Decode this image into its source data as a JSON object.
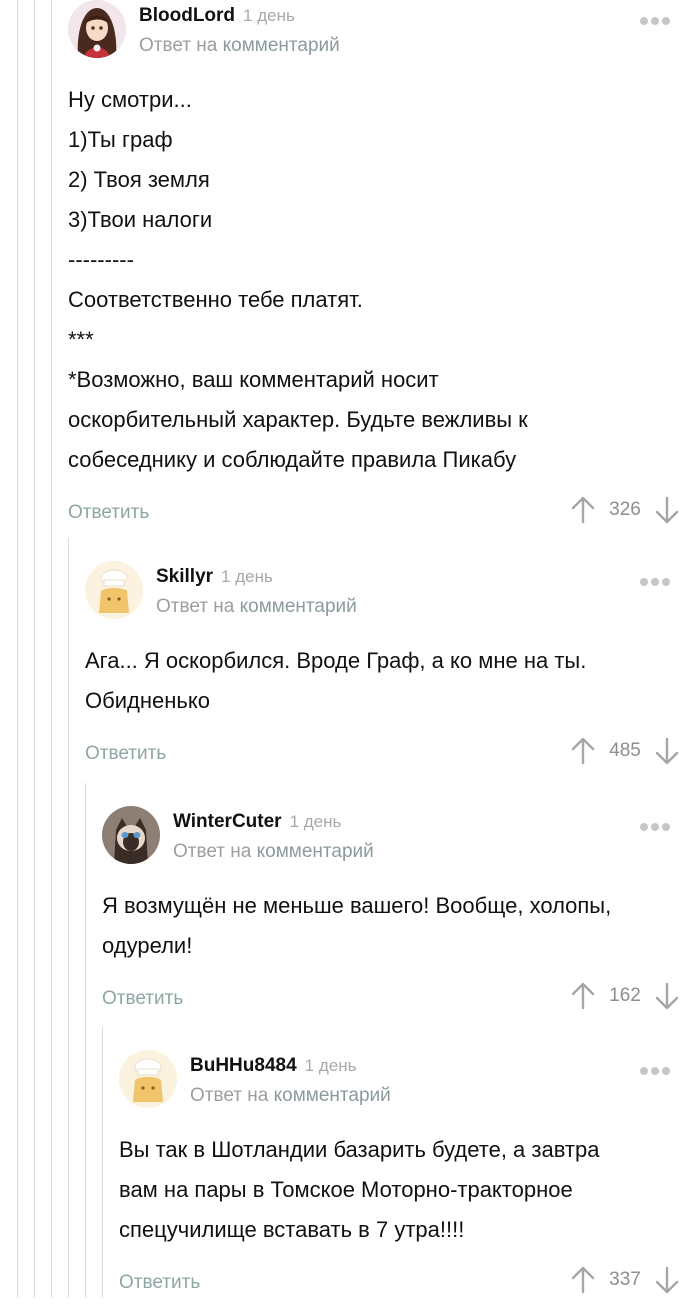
{
  "comments": [
    {
      "username": "BloodLord",
      "time": "1 день",
      "reply_prefix": "Ответ на",
      "reply_link": "комментарий",
      "lines": [
        "Ну смотри...",
        "1)Ты граф",
        "2) Твоя земля",
        "3)Твои налоги",
        "---------",
        "Соответственно тебе платят.",
        "***",
        "*Возможно, ваш комментарий носит",
        "оскорбительный характер. Будьте вежливы к",
        "собеседнику и соблюдайте правила Пикабу"
      ],
      "reply_label": "Ответить",
      "rating": "326"
    },
    {
      "username": "Skillyr",
      "time": "1 день",
      "reply_prefix": "Ответ на",
      "reply_link": "комментарий",
      "lines": [
        "Ага... Я оскорбился. Вроде Граф, а ко мне на ты.",
        "Обидненько"
      ],
      "reply_label": "Ответить",
      "rating": "485"
    },
    {
      "username": "WinterCuter",
      "time": "1 день",
      "reply_prefix": "Ответ на",
      "reply_link": "комментарий",
      "lines": [
        "Я возмущён не меньше вашего! Вообще, холопы,",
        "одурели!"
      ],
      "reply_label": "Ответить",
      "rating": "162"
    },
    {
      "username": "BuHHu8484",
      "time": "1 день",
      "reply_prefix": "Ответ на",
      "reply_link": "комментарий",
      "lines": [
        "Вы так в Шотландии базарить будете, а завтра",
        "вам на пары в Томское Моторно-тракторное",
        "спецучилище вставать в 7 утра!!!!"
      ],
      "reply_label": "Ответить",
      "rating": "337"
    }
  ],
  "icons": {
    "upvote": "arrow-up-icon",
    "downvote": "arrow-down-icon",
    "more": "more-dots-icon"
  },
  "colors": {
    "reply_link": "#8ea6a3",
    "meta": "#a9a9a9",
    "thread_line": "#dcdcdc"
  }
}
